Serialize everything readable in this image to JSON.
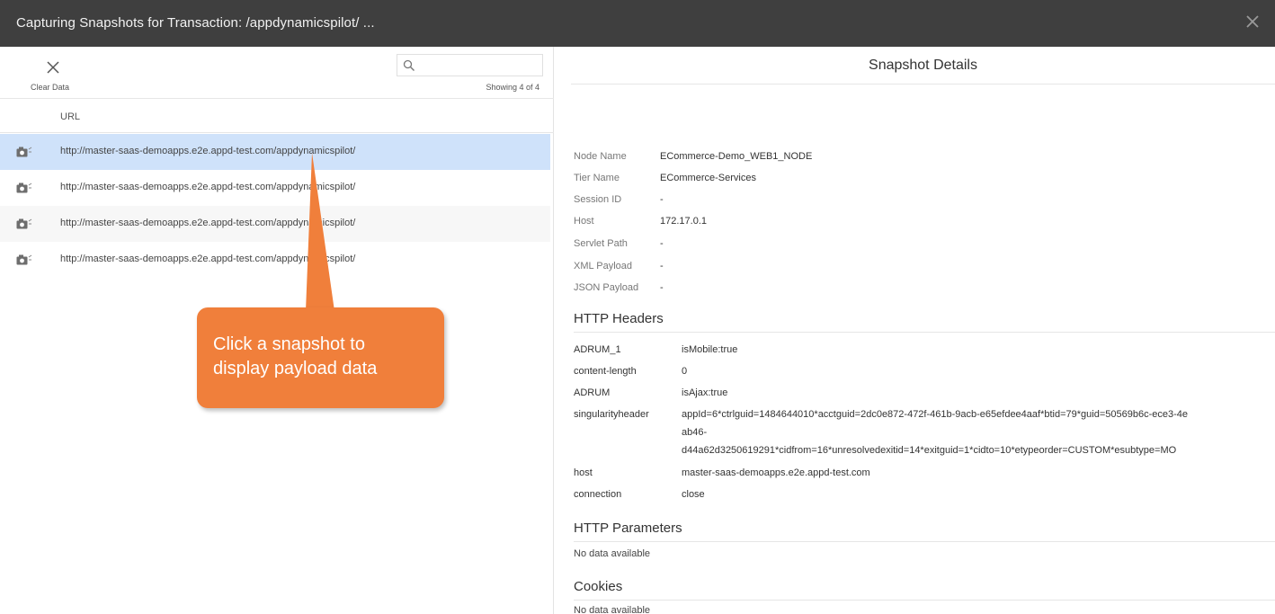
{
  "window": {
    "title": "Capturing Snapshots for Transaction: /appdynamicspilot/ ...",
    "close_icon": "close-icon"
  },
  "toolbar": {
    "clear_label": "Clear Data",
    "clear_icon": "close-icon",
    "search_icon": "search-icon",
    "search_value": "",
    "showing": "Showing 4 of 4"
  },
  "table": {
    "column_url": "URL",
    "row_icon": "camera-icon",
    "rows": [
      {
        "url": "http://master-saas-demoapps.e2e.appd-test.com/appdynamicspilot/",
        "selected": true
      },
      {
        "url": "http://master-saas-demoapps.e2e.appd-test.com/appdynamicspilot/",
        "selected": false
      },
      {
        "url": "http://master-saas-demoapps.e2e.appd-test.com/appdynamicspilot/",
        "selected": false
      },
      {
        "url": "http://master-saas-demoapps.e2e.appd-test.com/appdynamicspilot/",
        "selected": false
      }
    ]
  },
  "callout": {
    "line1": "Click a snapshot to",
    "line2": "display payload data",
    "color": "#f07f3b"
  },
  "details": {
    "title": "Snapshot Details",
    "fields": [
      {
        "label": "Node Name",
        "value": "ECommerce-Demo_WEB1_NODE"
      },
      {
        "label": "Tier Name",
        "value": "ECommerce-Services"
      },
      {
        "label": "Session ID",
        "value": "-"
      },
      {
        "label": "Host",
        "value": "172.17.0.1"
      },
      {
        "label": "Servlet Path",
        "value": "-"
      },
      {
        "label": "XML Payload",
        "value": "-"
      },
      {
        "label": "JSON Payload",
        "value": "-"
      }
    ],
    "http_headers_title": "HTTP Headers",
    "headers": [
      {
        "key": "ADRUM_1",
        "value": "isMobile:true"
      },
      {
        "key": "content-length",
        "value": "0"
      },
      {
        "key": "ADRUM",
        "value": "isAjax:true"
      },
      {
        "key": "singularityheader",
        "value_lines": [
          "appId=6*ctrlguid=1484644010*acctguid=2dc0e872-472f-461b-9acb-e65efdee4aaf*btid=79*guid=50569b6c-ece3-4e",
          "ab46-",
          "d44a62d3250619291*cidfrom=16*unresolvedexitid=14*exitguid=1*cidto=10*etypeorder=CUSTOM*esubtype=MO"
        ]
      },
      {
        "key": "host",
        "value": "master-saas-demoapps.e2e.appd-test.com"
      },
      {
        "key": "connection",
        "value": "close"
      }
    ],
    "http_parameters_title": "HTTP Parameters",
    "http_parameters_empty": "No data available",
    "cookies_title": "Cookies",
    "cookies_empty": "No data available"
  }
}
